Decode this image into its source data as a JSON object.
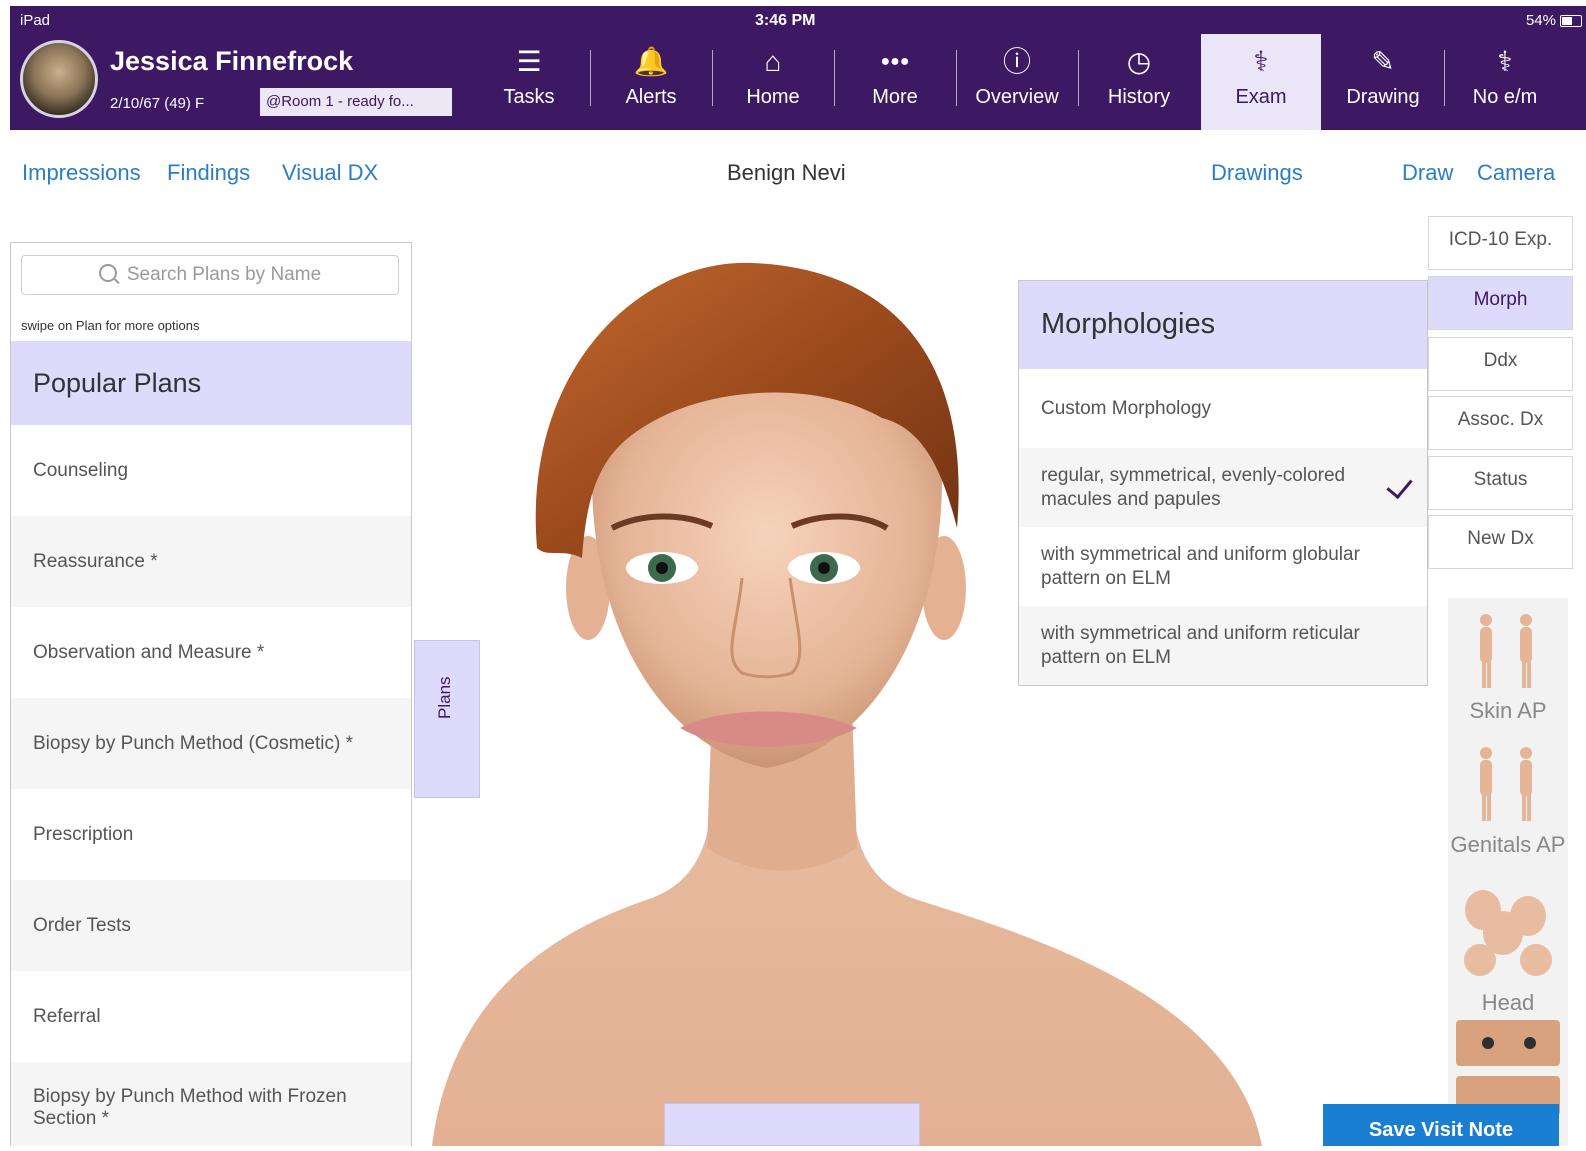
{
  "status_bar": {
    "device": "iPad",
    "time": "3:46 PM",
    "battery": "54%"
  },
  "patient": {
    "name": "Jessica Finnefrock",
    "dob_age_sex": "2/10/67 (49) F",
    "room_status": "@Room 1 - ready fo..."
  },
  "nav": [
    {
      "label": "Tasks",
      "icon": "tasks-icon",
      "glyph": "☰"
    },
    {
      "label": "Alerts",
      "icon": "bell-icon",
      "glyph": "🔔"
    },
    {
      "label": "Home",
      "icon": "home-icon",
      "glyph": "⌂"
    },
    {
      "label": "More",
      "icon": "more-icon",
      "glyph": "●●●"
    },
    {
      "label": "Overview",
      "icon": "info-icon",
      "glyph": "ⓘ"
    },
    {
      "label": "History",
      "icon": "clock-icon",
      "glyph": "◷"
    },
    {
      "label": "Exam",
      "icon": "stethoscope-icon",
      "glyph": "⚕"
    },
    {
      "label": "Drawing",
      "icon": "pencil-icon",
      "glyph": "✎"
    },
    {
      "label": "No e/m",
      "icon": "caduceus-icon",
      "glyph": "⚕"
    }
  ],
  "active_nav": "Exam",
  "subnav": {
    "impressions": "Impressions",
    "findings": "Findings",
    "visual_dx": "Visual DX",
    "title": "Benign Nevi",
    "drawings": "Drawings",
    "draw": "Draw",
    "camera": "Camera"
  },
  "plans": {
    "search_placeholder": "Search Plans by Name",
    "hint": "swipe on Plan for more options",
    "header": "Popular Plans",
    "items": [
      "Counseling",
      "Reassurance *",
      "Observation and Measure *",
      "Biopsy by Punch Method (Cosmetic) *",
      "Prescription",
      "Order Tests",
      "Referral",
      "Biopsy by Punch Method with Frozen Section *"
    ],
    "tab_label": "Plans"
  },
  "morphologies": {
    "title": "Morphologies",
    "items": [
      {
        "label": "Custom Morphology",
        "checked": false
      },
      {
        "label": "regular, symmetrical, evenly-colored macules and papules",
        "checked": true
      },
      {
        "label": "with symmetrical and uniform globular pattern on ELM",
        "checked": false
      },
      {
        "label": "with symmetrical and uniform reticular pattern on ELM",
        "checked": false
      }
    ]
  },
  "side_tabs": [
    "ICD-10 Exp.",
    "Morph",
    "Ddx",
    "Assoc. Dx",
    "Status",
    "New Dx"
  ],
  "active_side_tab": "Morph",
  "body_views": [
    "Skin AP",
    "Genitals AP",
    "Head"
  ],
  "save_button": "Save Visit Note",
  "colors": {
    "header": "#3d1863",
    "accent_lavender": "#dedafb",
    "link": "#2a7ec2",
    "save": "#1b7fd1"
  }
}
